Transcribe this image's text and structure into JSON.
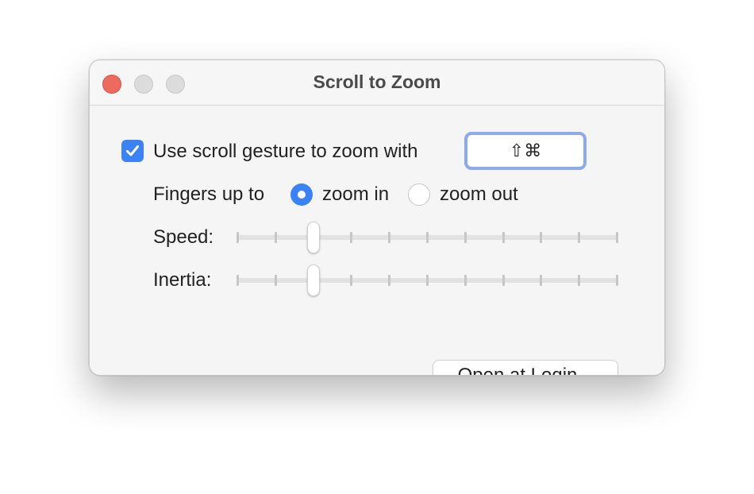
{
  "window": {
    "title": "Scroll to Zoom"
  },
  "settings": {
    "scroll_gesture_checkbox": {
      "label": "Use scroll gesture to zoom with",
      "checked": true
    },
    "shortcut": {
      "value": "⇧⌘"
    },
    "fingers": {
      "label": "Fingers up to",
      "options": [
        {
          "label": "zoom in",
          "selected": true
        },
        {
          "label": "zoom out",
          "selected": false
        }
      ]
    },
    "speed": {
      "label": "Speed:",
      "tick_count": 11,
      "value_index": 2
    },
    "inertia": {
      "label": "Inertia:",
      "tick_count": 11,
      "value_index": 2
    },
    "login_button": {
      "label": "Open at Login..."
    }
  },
  "colors": {
    "accent": "#3b82f6",
    "close": "#ed6a5e",
    "focus_ring": "#8ea9ec"
  }
}
